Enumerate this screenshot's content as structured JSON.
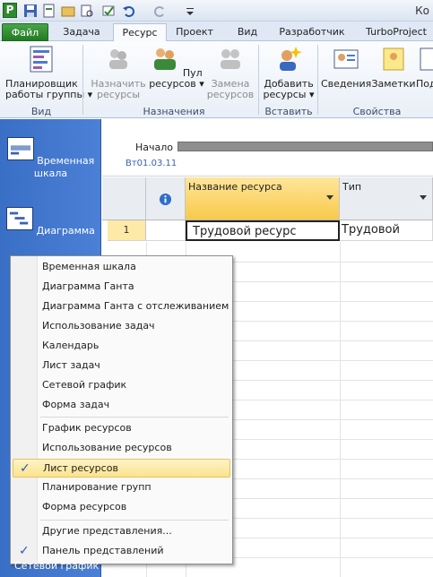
{
  "app": {
    "icon_letter": "P",
    "window_title": "Ко"
  },
  "tabs": [
    "Файл",
    "Задача",
    "Ресурс",
    "Проект",
    "Вид",
    "Разработчик",
    "TurboProject"
  ],
  "ribbon": {
    "view_group": {
      "button": "Планировщик\nработы группы ▾",
      "label": "Вид"
    },
    "assign_group": {
      "buttons": [
        "Назначить\nресурсы",
        "Пул\nресурсов ▾",
        "Замена\nресурсов"
      ],
      "label": "Назначения"
    },
    "insert_group": {
      "button": "Добавить\nресурсы ▾",
      "label": "Вставить"
    },
    "props_group": {
      "buttons": [
        "Сведения",
        "Заметки",
        "Подр"
      ],
      "label": "Свойства"
    }
  },
  "viewbar": {
    "items": [
      "Временная\nшкала",
      "Диаграмма"
    ],
    "bottom": "Сетевой график"
  },
  "timeline": {
    "start_label": "Начало",
    "start_date": "Вт01.03.11"
  },
  "grid": {
    "headers": [
      "Название ресурса",
      "Тип"
    ],
    "rows": [
      {
        "id": "1",
        "name": "Трудовой ресурс",
        "type": "Трудовой"
      }
    ]
  },
  "menu": {
    "items": [
      "Временная шкала",
      "Диаграмма Ганта",
      "Диаграмма Ганта с отслеживанием",
      "Использование задач",
      "Календарь",
      "Лист задач",
      "Сетевой график",
      "Форма задач",
      "График ресурсов",
      "Использование ресурсов",
      "Лист ресурсов",
      "Планирование групп",
      "Форма ресурсов",
      "Другие представления...",
      "Панель представлений"
    ]
  }
}
